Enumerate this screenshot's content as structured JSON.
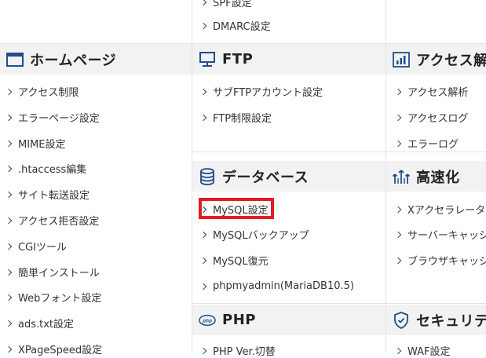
{
  "colors": {
    "accent": "#1f4e8c",
    "highlight": "#e51c23",
    "header_bg": "#f2f2f2",
    "divider": "#e3e3e3"
  },
  "col1": {
    "header": {
      "title": "ホームページ",
      "icon": "browser-window-icon"
    },
    "links": [
      "アクセス制限",
      "エラーページ設定",
      "MIME設定",
      ".htaccess編集",
      "サイト転送設定",
      "アクセス拒否設定",
      "CGIツール",
      "簡単インストール",
      "Webフォント設定",
      "ads.txt設定",
      "XPageSpeed設定"
    ]
  },
  "col2": {
    "top_links": [
      "SPF設定",
      "DMARC設定"
    ],
    "ftp": {
      "title": "FTP",
      "icon": "monitor-icon",
      "links": [
        "サブFTPアカウント設定",
        "FTP制限設定"
      ]
    },
    "db": {
      "title": "データベース",
      "icon": "database-icon",
      "links": [
        "MySQL設定",
        "MySQLバックアップ",
        "MySQL復元",
        "phpmyadmin(MariaDB10.5)"
      ]
    },
    "php": {
      "title": "PHP",
      "icon": "php-icon",
      "links": [
        "PHP Ver.切替"
      ]
    }
  },
  "col3": {
    "access": {
      "title": "アクセス解",
      "icon": "bar-chart-icon",
      "links": [
        "アクセス解析",
        "アクセスログ",
        "エラーログ"
      ]
    },
    "speed": {
      "title": "高速化",
      "icon": "rocket-arrows-icon",
      "links": [
        "Xアクセラレータ",
        "サーバーキャッシ",
        "ブラウザキャッシ"
      ]
    },
    "security": {
      "title": "セキュリテ",
      "icon": "shield-check-icon",
      "links": [
        "WAF設定"
      ]
    }
  }
}
